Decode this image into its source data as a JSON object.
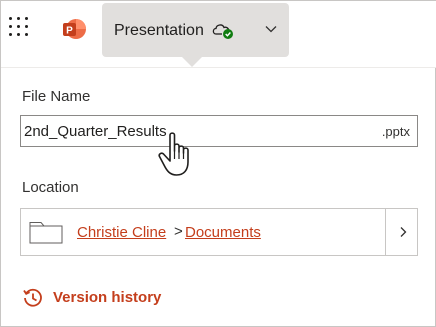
{
  "header": {
    "app_icon": "powerpoint-icon",
    "title": "Presentation",
    "sync_status_icon": "cloud-check-icon",
    "colors": {
      "accent": "#c43e1c",
      "tab_background": "#e1dfdd",
      "status_ok": "#107c10"
    }
  },
  "file_name": {
    "label": "File Name",
    "value": "2nd_Quarter_Results",
    "extension": ".pptx"
  },
  "location": {
    "label": "Location",
    "breadcrumb": [
      "Christie Cline",
      "Documents"
    ],
    "separator": ">"
  },
  "version_history": {
    "label": "Version history"
  }
}
